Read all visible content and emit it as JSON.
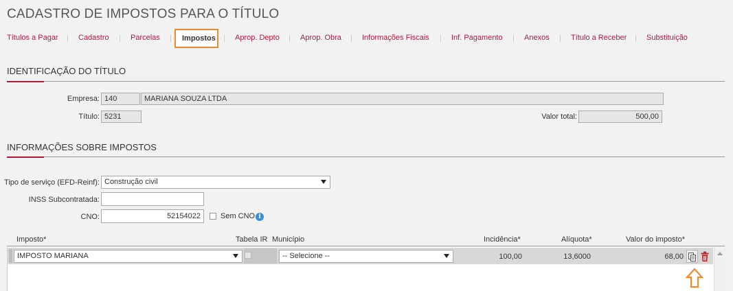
{
  "page": {
    "title": "CADASTRO DE IMPOSTOS PARA O TÍTULO"
  },
  "nav": {
    "items": [
      "Títulos a Pagar",
      "Cadastro",
      "Parcelas",
      "Impostos",
      "Aprop. Depto",
      "Aprop. Obra",
      "Informações Fiscais",
      "Inf. Pagamento",
      "Anexos",
      "Título a Receber",
      "Substituição"
    ],
    "active": "Impostos"
  },
  "identificacao": {
    "title": "IDENTIFICAÇÃO DO TÍTULO",
    "empresa_label": "Empresa:",
    "empresa_code": "140",
    "empresa_name": "MARIANA SOUZA LTDA",
    "titulo_label": "Título:",
    "titulo_value": "5231",
    "valor_total_label": "Valor total:",
    "valor_total_value": "500,00"
  },
  "impostos": {
    "title": "INFORMAÇÕES SOBRE IMPOSTOS",
    "tipo_servico_label": "Tipo de serviço (EFD-Reinf):",
    "tipo_servico_value": "Construção civil",
    "inss_label": "INSS Subcontratada:",
    "inss_value": "",
    "cno_label": "CNO:",
    "cno_value": "52154022",
    "sem_cno_label": "Sem CNO",
    "info_icon": "i"
  },
  "table": {
    "headers": {
      "imposto": "Imposto*",
      "tabela_ir": "Tabela IR",
      "municipio": "Município",
      "incidencia": "Incidência*",
      "aliquota": "Alíquota*",
      "valor": "Valor do imposto*"
    },
    "rows": [
      {
        "imposto": "IMPOSTO MARIANA",
        "municipio": "-- Selecione --",
        "incidencia": "100,00",
        "aliquota": "13,6000",
        "valor": "68,00"
      }
    ]
  },
  "colors": {
    "accent": "#b0183a",
    "highlight": "#f08a2c",
    "delete": "#c0272d",
    "info": "#3a8fd6"
  },
  "icons": {
    "copy": "copy-icon",
    "delete": "trash-icon",
    "pointer": "up-arrow-icon"
  }
}
